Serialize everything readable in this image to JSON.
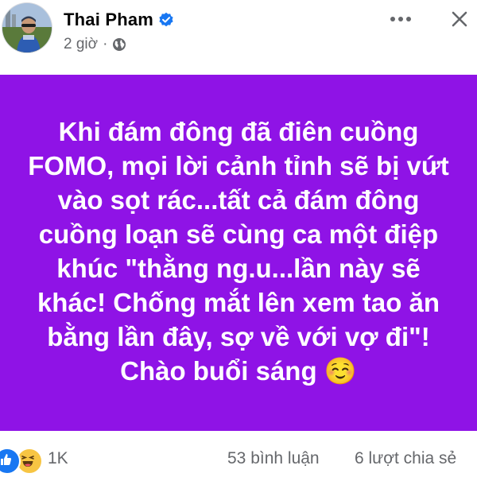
{
  "post": {
    "author": {
      "name": "Thai Pham",
      "verified": true,
      "avatar_icon": "profile-photo"
    },
    "meta": {
      "time": "2 giờ",
      "separator": "·",
      "audience_icon": "globe-icon"
    },
    "actions": {
      "more_icon": "more-dots-icon",
      "close_icon": "close-icon"
    },
    "content": {
      "background_color": "#8f13e6",
      "text_color": "#ffffff",
      "text": "Khi đám đông đã điên cuồng\nFOMO, mọi lời cảnh tỉnh sẽ bị vứt\nvào sọt rác...tất cả đám đông\ncuồng loạn sẽ cùng ca một điệp\nkhúc \"thằng ng.u...lần này sẽ\nkhác! Chống mắt lên xem tao ăn\nbằng lần đây, sợ về với vợ đi\"!\nChào buổi sáng ☺️"
    },
    "stats": {
      "reaction_icons": [
        "like-icon",
        "haha-icon"
      ],
      "reactions": "1K",
      "comments": "53 bình luận",
      "shares": "6 lượt chia sẻ"
    },
    "colors": {
      "verified_badge": "#1877f2",
      "secondary_text": "#65676b",
      "primary_text": "#050505"
    }
  }
}
